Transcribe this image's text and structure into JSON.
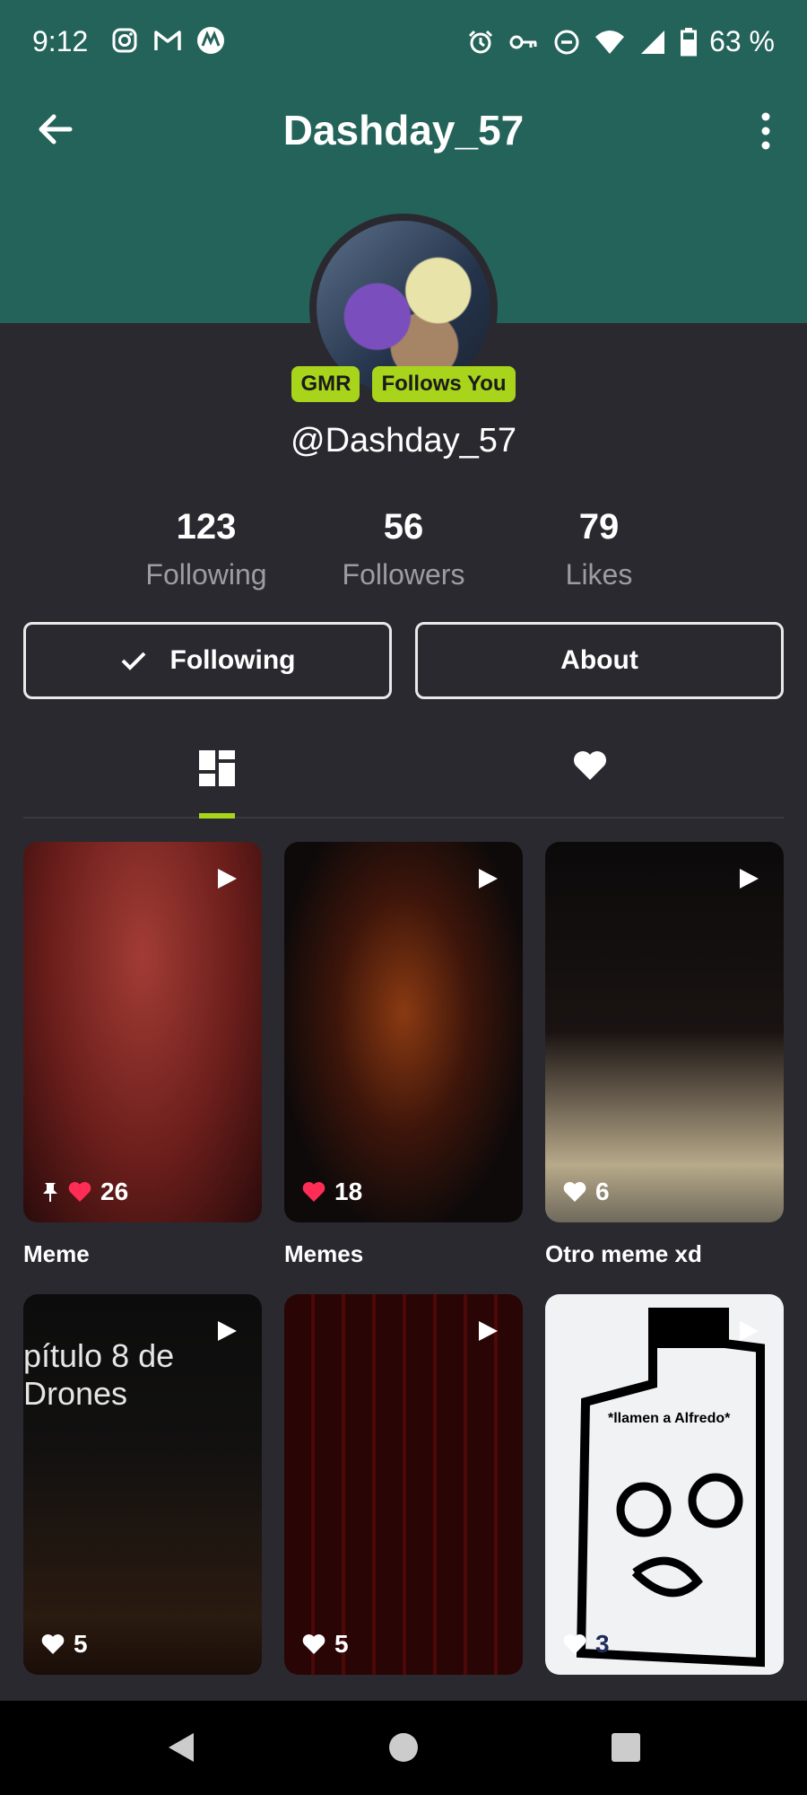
{
  "status_bar": {
    "time": "9:12",
    "battery": "63 %",
    "left_icons": [
      "instagram-icon",
      "gmail-icon",
      "motorola-icon"
    ],
    "right_icons": [
      "alarm-icon",
      "key-icon",
      "do-not-disturb-icon",
      "wifi-icon",
      "signal-icon",
      "battery-icon"
    ]
  },
  "header": {
    "title": "Dashday_57"
  },
  "profile": {
    "badges": [
      "GMR",
      "Follows You"
    ],
    "handle": "@Dashday_57"
  },
  "stats": [
    {
      "value": "123",
      "label": "Following"
    },
    {
      "value": "56",
      "label": "Followers"
    },
    {
      "value": "79",
      "label": "Likes"
    }
  ],
  "actions": {
    "following_label": "Following",
    "about_label": "About"
  },
  "posts": [
    {
      "title": "Meme",
      "likes": "26",
      "pinned": true,
      "liked": true
    },
    {
      "title": "Memes",
      "likes": "18",
      "pinned": false,
      "liked": true
    },
    {
      "title": "Otro meme xd",
      "likes": "6",
      "pinned": false,
      "liked": false
    },
    {
      "title": "",
      "likes": "5",
      "pinned": false,
      "liked": false,
      "overlay_text": "pítulo 8 de\nDrones"
    },
    {
      "title": "",
      "likes": "5",
      "pinned": false,
      "liked": false
    },
    {
      "title": "",
      "likes": "3",
      "pinned": false,
      "liked": false,
      "overlay_text": "*llamen a Alfredo*"
    }
  ],
  "colors": {
    "header_bg": "#24635a",
    "page_bg": "#2a2930",
    "accent": "#a8d41b",
    "like_red": "#ff2d55"
  }
}
